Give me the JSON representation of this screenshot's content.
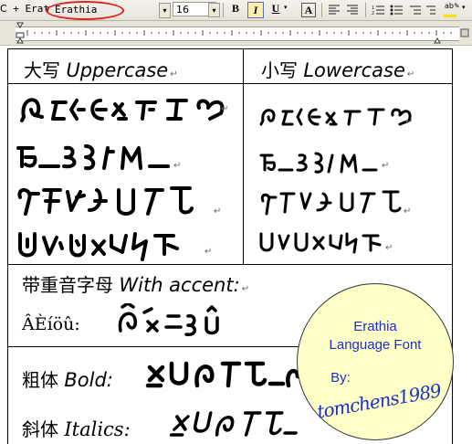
{
  "toolbar": {
    "style_prefix": "Ⅽ + Erat",
    "font_name": "Erathia",
    "font_size": "16",
    "bold_label": "B",
    "italic_label": "I",
    "underline_label": "U",
    "char_label": "A"
  },
  "table": {
    "header_upper": {
      "cjk": "大写",
      "latin": "Uppercase"
    },
    "header_lower": {
      "cjk": "小写",
      "latin": "Lowercase"
    },
    "accent": {
      "cjk": "带重音字母",
      "latin": "With accent:"
    },
    "accent_sample": "ÂÈíöû:",
    "bold": {
      "cjk": "粗体",
      "latin": "Bold:"
    },
    "italic": {
      "cjk": "斜体",
      "latin": "Italics:"
    },
    "para_mark": "↵"
  },
  "badge": {
    "line1": "Erathia",
    "line2": "Language Font",
    "line3": "By:",
    "signature": "tomchens1989"
  },
  "colors": {
    "highlight_oval": "#e0201a",
    "badge_fill": "#ffffc8",
    "badge_text": "#1a2fc8"
  }
}
